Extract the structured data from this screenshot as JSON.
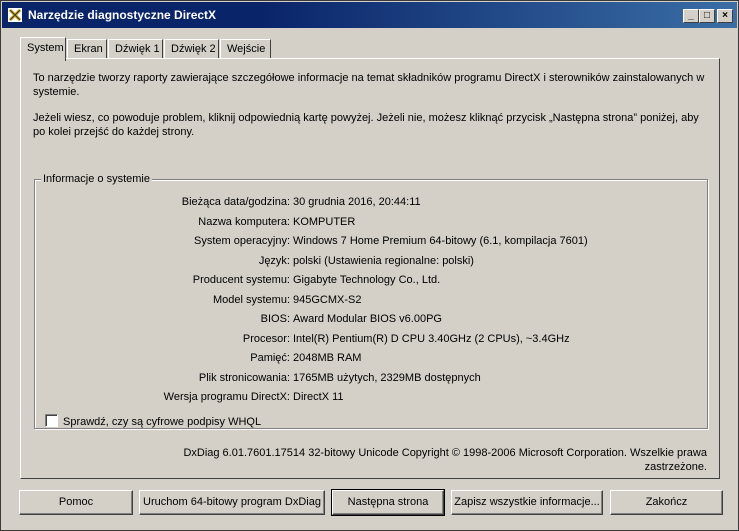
{
  "window": {
    "title": "Narzędzie diagnostyczne DirectX",
    "controls": {
      "minimize": "_",
      "maximize": "□",
      "close": "×"
    }
  },
  "tabs": [
    "System",
    "Ekran",
    "Dźwięk 1",
    "Dźwięk 2",
    "Wejście"
  ],
  "active_tab": "System",
  "intro": {
    "p1": "To narzędzie tworzy raporty zawierające szczegółowe informacje na temat składników programu DirectX i sterowników zainstalowanych w systemie.",
    "p2": "Jeżeli wiesz, co powoduje problem, kliknij odpowiednią kartę powyżej. Jeżeli nie, możesz kliknąć przycisk „Następna strona” poniżej, aby po kolei przejść do każdej strony."
  },
  "system_info": {
    "title": "Informacje o systemie",
    "rows": [
      {
        "label": "Bieżąca data/godzina:",
        "value": "30 grudnia 2016, 20:44:11"
      },
      {
        "label": "Nazwa komputera:",
        "value": "KOMPUTER"
      },
      {
        "label": "System operacyjny:",
        "value": "Windows 7 Home Premium 64-bitowy (6.1, kompilacja 7601)"
      },
      {
        "label": "Język:",
        "value": "polski (Ustawienia regionalne: polski)"
      },
      {
        "label": "Producent systemu:",
        "value": "Gigabyte Technology Co., Ltd."
      },
      {
        "label": "Model systemu:",
        "value": "945GCMX-S2"
      },
      {
        "label": "BIOS:",
        "value": "Award Modular BIOS v6.00PG"
      },
      {
        "label": "Procesor:",
        "value": "Intel(R) Pentium(R) D CPU 3.40GHz (2 CPUs), ~3.4GHz"
      },
      {
        "label": "Pamięć:",
        "value": "2048MB RAM"
      },
      {
        "label": "Plik stronicowania:",
        "value": "1765MB użytych, 2329MB dostępnych"
      },
      {
        "label": "Wersja programu DirectX:",
        "value": "DirectX 11"
      }
    ],
    "whql_checkbox": {
      "label": "Sprawdź, czy są cyfrowe podpisy WHQL",
      "checked": false
    }
  },
  "footer": {
    "copyright": "DxDiag 6.01.7601.17514 32-bitowy Unicode  Copyright © 1998-2006 Microsoft Corporation. Wszelkie prawa zastrzeżone."
  },
  "buttons": {
    "help": "Pomoc",
    "run64": "Uruchom 64-bitowy program DxDiag",
    "next": "Następna strona",
    "save": "Zapisz wszystkie informacje...",
    "exit": "Zakończ"
  },
  "colors": {
    "title_bar_start": "#0a246a",
    "title_bar_end": "#3a6ea5",
    "face": "#d4d0c8"
  }
}
